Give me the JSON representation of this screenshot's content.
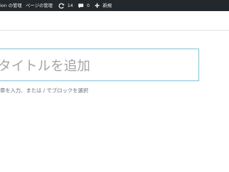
{
  "admin_bar": {
    "site_label": "ion の管理",
    "customize_label": "ページの管理",
    "updates_count": "14",
    "comments_count": "0",
    "new_label": "新規"
  },
  "editor": {
    "title_placeholder": "タイトルを追加",
    "block_placeholder": "章を入力、または / でブロックを選択"
  },
  "colors": {
    "admin_bar_bg": "#23282d",
    "title_border": "#7ec1d9",
    "placeholder_text": "#a2a5a8"
  }
}
